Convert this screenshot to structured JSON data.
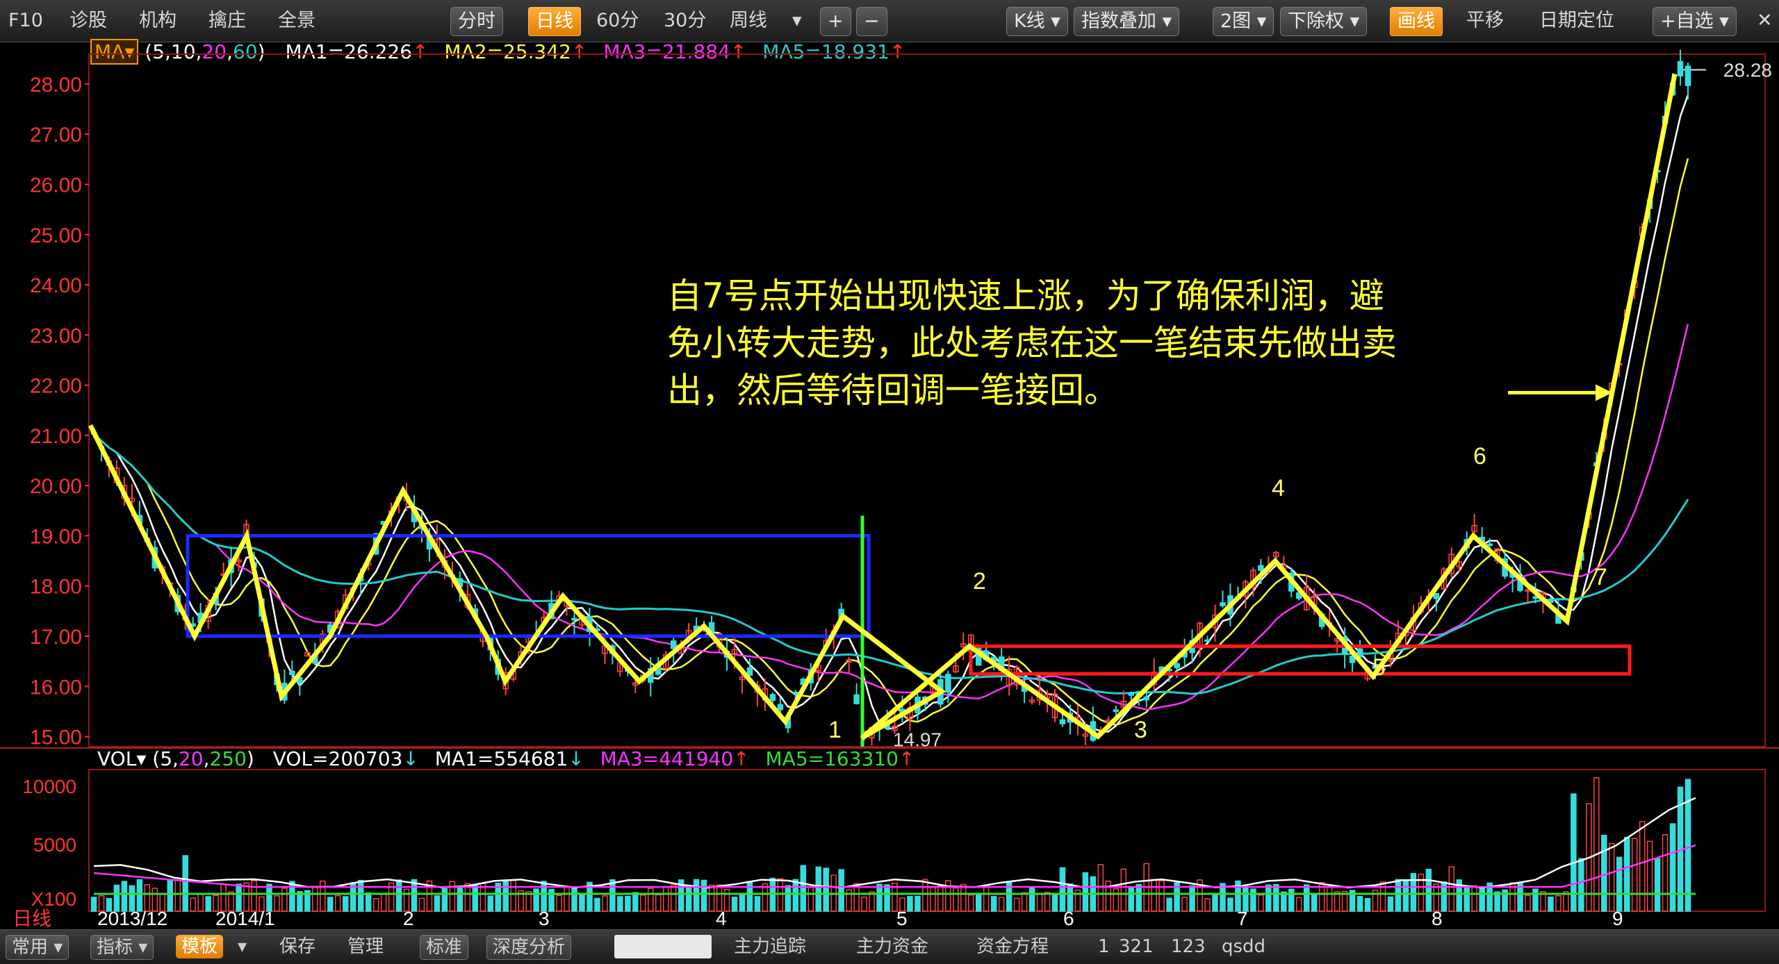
{
  "toolbar": {
    "items": [
      "F10",
      "诊股",
      "机构",
      "擒庄",
      "全景"
    ],
    "period_tabs": [
      "分时",
      "日线",
      "60分",
      "30分",
      "周线"
    ],
    "active_period": "日线",
    "zoom": [
      "+",
      "−"
    ],
    "right_items": [
      "K线",
      "指数叠加",
      "2图",
      "下除权",
      "画线",
      "平移",
      "日期定位",
      "+自选"
    ],
    "active_right": "画线",
    "close": "✕"
  },
  "legend": {
    "label": "MA",
    "params_prefix": "(5,10,",
    "param20": "20",
    "param_sep": ",",
    "param60": "60",
    "params_suffix": ")",
    "ma1": "MA1=26.226",
    "ma2": "MA2=25.342",
    "ma3": "MA3=21.884",
    "ma5": "MA5=18.931",
    "arrow": "↑"
  },
  "vol_legend": {
    "label": "VOL",
    "params_prefix": "(5,",
    "param20": "20",
    "param_sep": ",",
    "param250": "250",
    "params_suffix": ")",
    "vol": "VOL=200703",
    "ma1": "MA1=554681",
    "ma3": "MA3=441940",
    "ma5": "MA5=163310",
    "down": "↓",
    "up": "↑"
  },
  "annotation": {
    "line1": "自7号点开始出现快速上涨，为了确保利润，避",
    "line2": "免小转大走势，此处考虑在这一笔结束先做出卖",
    "line3": "出，然后等待回调一笔接回。"
  },
  "date_axis": {
    "period_label": "日线",
    "labels": [
      "2013/12",
      "2014/1",
      "2",
      "3",
      "4",
      "5",
      "6",
      "7",
      "8",
      "9"
    ]
  },
  "bottom": {
    "items": [
      "常用",
      "指标",
      "模板",
      "保存",
      "管理",
      "标准",
      "深度分析",
      "主力追踪",
      "主力资金",
      "资金方程",
      "1",
      "321",
      "123",
      "qsdd"
    ],
    "active": "模板"
  },
  "colors": {
    "ma1": "#ffffff",
    "ma2": "#ffff33",
    "ma3": "#ff33ff",
    "ma5": "#22cccc",
    "up": "#ff4444",
    "down": "#33dddd",
    "stroke": "#ffff33",
    "blue_box": "#1a2bff",
    "red_box": "#ff1a1a",
    "green_line": "#33ff33"
  },
  "chart_data": [
    {
      "type": "candlestick",
      "title": "",
      "y_ticks": [
        "28.00",
        "27.00",
        "26.00",
        "25.00",
        "24.00",
        "23.00",
        "22.00",
        "21.00",
        "20.00",
        "19.00",
        "18.00",
        "17.00",
        "16.00",
        "15.00"
      ],
      "ylim": [
        14.8,
        28.4
      ],
      "annotations": {
        "high_label": "28.28",
        "low_label": "14.97",
        "point_labels": [
          "1",
          "2",
          "3",
          "4",
          "5",
          "6",
          "7"
        ]
      },
      "stroke_vertices": [
        21.2,
        17.0,
        19.0,
        15.8,
        17.0,
        19.9,
        17.0,
        16.1,
        17.8,
        16.1,
        17.2,
        15.3,
        17.4,
        15.9,
        14.97,
        16.8,
        15.0,
        18.5,
        16.2,
        19.0,
        17.3,
        28.2
      ],
      "stroke_point_labels": {
        "1": 14.97,
        "2": 16.8,
        "3": 15.0,
        "4": 18.5,
        "5": 16.2,
        "6": 19.0,
        "7": 17.3
      },
      "blue_box": {
        "top": 19.0,
        "bottom": 17.0
      },
      "red_box": {
        "top": 16.8,
        "bottom": 16.25
      },
      "series": [
        {
          "name": "MA1",
          "value": 26.226
        },
        {
          "name": "MA2",
          "value": 25.342
        },
        {
          "name": "MA3",
          "value": 21.884
        },
        {
          "name": "MA5",
          "value": 18.931
        }
      ]
    },
    {
      "type": "bar",
      "title": "",
      "y_ticks": [
        "10000",
        "5000",
        "X100"
      ],
      "series": [
        {
          "name": "VOL",
          "value": 200703
        },
        {
          "name": "MA1",
          "value": 554681
        },
        {
          "name": "MA3",
          "value": 441940
        },
        {
          "name": "MA5",
          "value": 163310
        }
      ]
    }
  ]
}
